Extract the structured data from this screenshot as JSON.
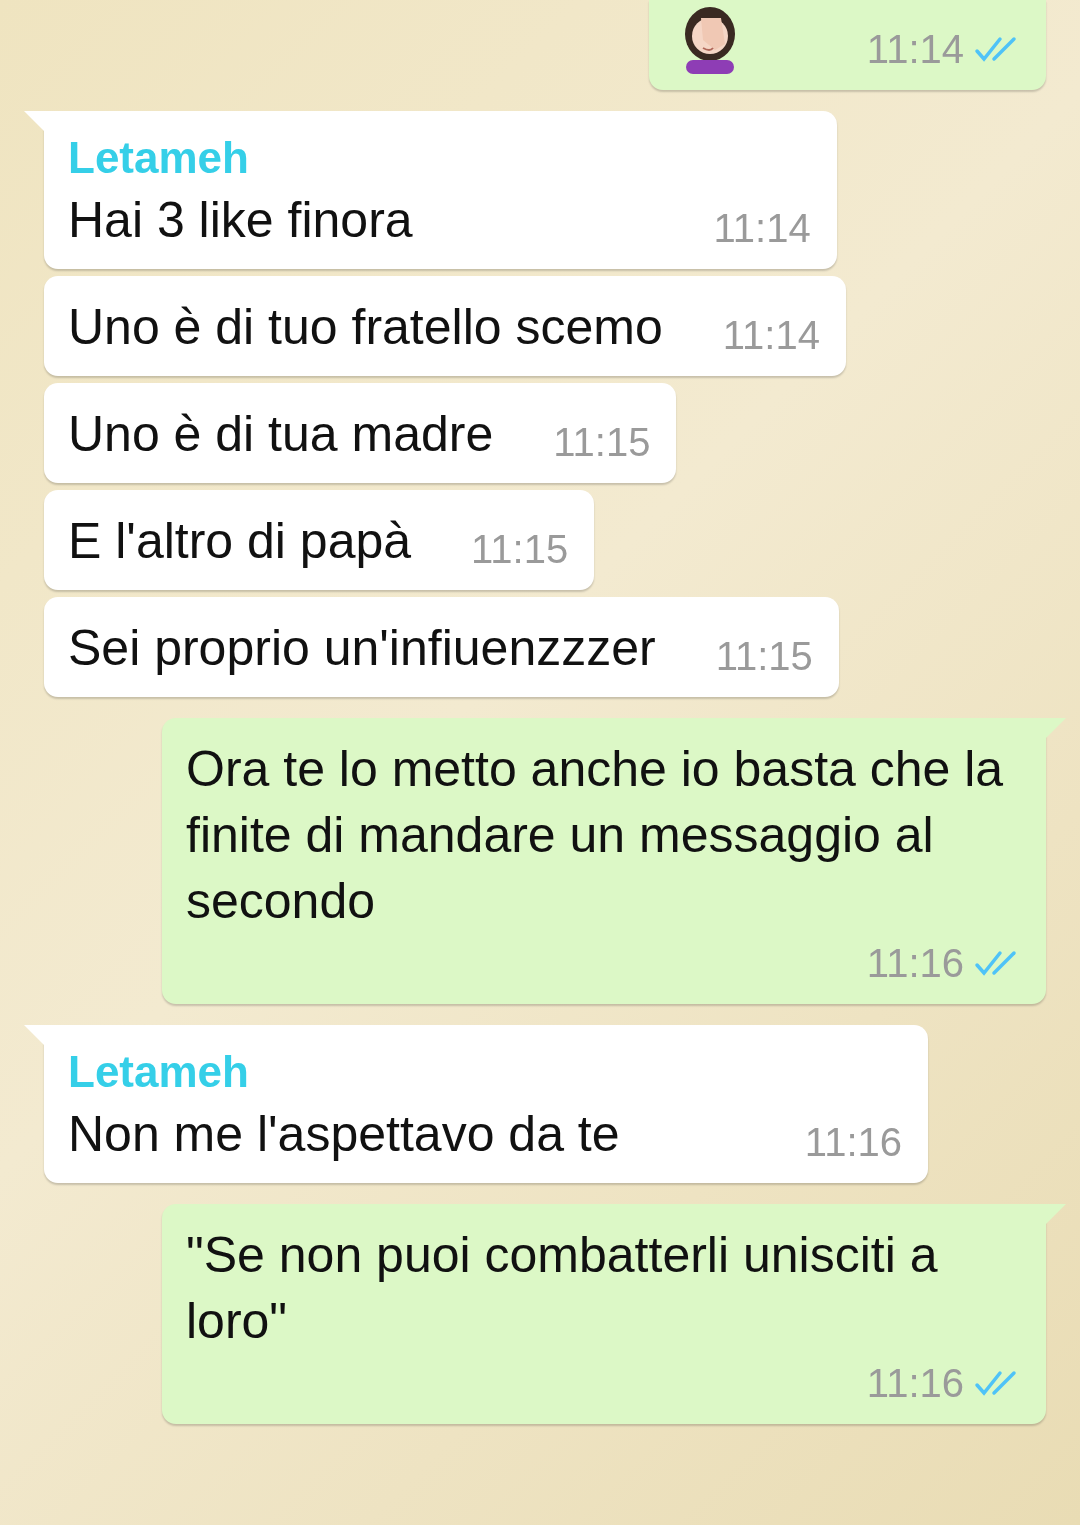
{
  "messages": [
    {
      "outgoing": true,
      "kind": "emoji",
      "tail": false,
      "time": "11:14",
      "read": true
    },
    {
      "outgoing": false,
      "kind": "text",
      "tail": true,
      "sender": "Letameh",
      "text": "Hai 3 like finora",
      "time": "11:14"
    },
    {
      "outgoing": false,
      "kind": "text",
      "tail": false,
      "text": "Uno è di tuo fratello scemo",
      "time": "11:14"
    },
    {
      "outgoing": false,
      "kind": "text",
      "tail": false,
      "text": "Uno è di tua madre",
      "time": "11:15"
    },
    {
      "outgoing": false,
      "kind": "text",
      "tail": false,
      "text": "E l'altro di papà",
      "time": "11:15"
    },
    {
      "outgoing": false,
      "kind": "text",
      "tail": false,
      "text": "Sei proprio un'infiuenzzzer",
      "time": "11:15"
    },
    {
      "outgoing": true,
      "kind": "text",
      "tail": true,
      "text": "Ora te lo metto anche io basta che la finite di mandare un messaggio al secondo",
      "time": "11:16",
      "read": true
    },
    {
      "outgoing": false,
      "kind": "text",
      "tail": true,
      "sender": "Letameh",
      "text": "Non me l'aspettavo da te",
      "time": "11:16"
    },
    {
      "outgoing": true,
      "kind": "text",
      "tail": true,
      "text": "\"Se non puoi combatterli unisciti a loro\"",
      "time": "11:16",
      "read": true
    }
  ]
}
